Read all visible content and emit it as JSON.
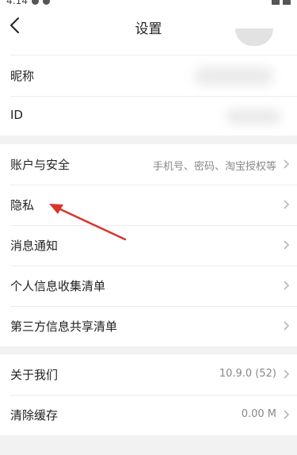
{
  "status_bar": {
    "time": "4:14"
  },
  "header": {
    "title": "设置"
  },
  "profile": {
    "nickname_label": "昵称",
    "id_label": "ID"
  },
  "account_section": {
    "items": [
      {
        "label": "账户与安全",
        "value": "手机号、密码、淘宝授权等"
      },
      {
        "label": "隐私"
      },
      {
        "label": "消息通知"
      },
      {
        "label": "个人信息收集清单"
      },
      {
        "label": "第三方信息共享清单"
      }
    ]
  },
  "about_section": {
    "items": [
      {
        "label": "关于我们",
        "value": "10.9.0 (52)"
      },
      {
        "label": "清除缓存",
        "value": "0.00 M"
      }
    ]
  },
  "colors": {
    "background": "#f2f2f2",
    "card": "#ffffff",
    "annotation_arrow": "#d9342b"
  },
  "icons": {
    "back": "chevron-left-icon",
    "row_arrow": "chevron-right-icon"
  }
}
